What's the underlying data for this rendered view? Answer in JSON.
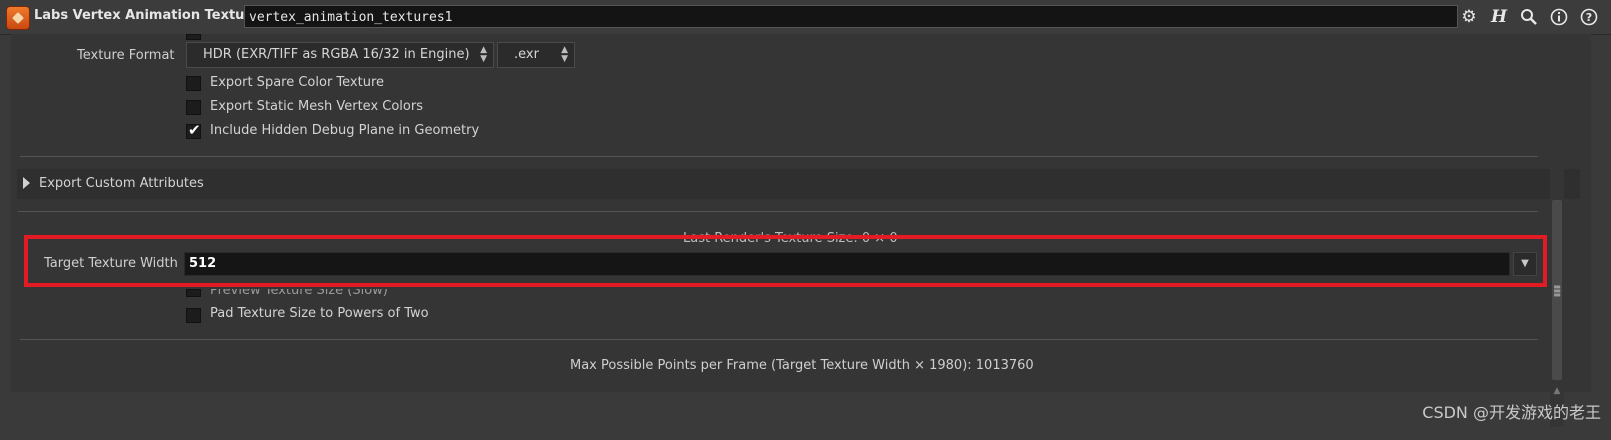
{
  "header": {
    "title": "Labs Vertex Animation Textures",
    "node_name": "vertex_animation_textures1",
    "icons": [
      "gear-icon",
      "houdini-h-icon",
      "search-icon",
      "info-icon",
      "help-icon"
    ]
  },
  "texture_format": {
    "label": "Texture Format",
    "format_value": "HDR (EXR/TIFF as RGBA 16/32 in Engine)",
    "extension_value": ".exr"
  },
  "checkboxes_top": [
    {
      "label": "Export Spare Color Texture",
      "checked": false
    },
    {
      "label": "Export Static Mesh Vertex Colors",
      "checked": false
    },
    {
      "label": "Include Hidden Debug Plane in Geometry",
      "checked": true
    }
  ],
  "export_custom_attributes": {
    "label": "Export Custom Attributes"
  },
  "last_render": {
    "label": "Last Render's Texture Size: 0 × 0"
  },
  "target_width": {
    "label": "Target Texture Width",
    "value": "512"
  },
  "checkboxes_bottom": [
    {
      "label": "Preview Texture Size (Slow)",
      "checked": false
    },
    {
      "label": "Pad Texture Size to Powers of Two",
      "checked": false
    }
  ],
  "max_points": {
    "label": "Max Possible Points per Frame (Target Texture Width × 1980): 1013760"
  },
  "watermark": "CSDN @开发游戏的老王",
  "colors": {
    "highlight": "#e21b25",
    "accent": "#f07a2c"
  }
}
